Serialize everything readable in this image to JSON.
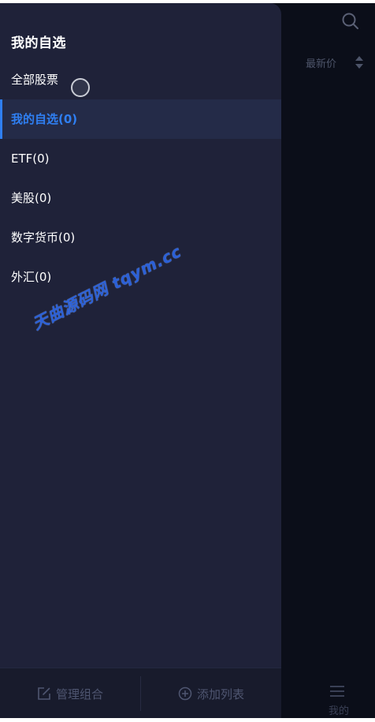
{
  "background": {
    "sort_label": "最新价",
    "nav_label": "我的"
  },
  "drawer": {
    "title": "我的自选",
    "items": [
      {
        "label": "全部股票",
        "active": false
      },
      {
        "label": "我的自选(0)",
        "active": true
      },
      {
        "label": "ETF(0)",
        "active": false
      },
      {
        "label": "美股(0)",
        "active": false
      },
      {
        "label": "数字货币(0)",
        "active": false
      },
      {
        "label": "外汇(0)",
        "active": false
      }
    ],
    "footer": {
      "manage_label": "管理组合",
      "add_label": "添加列表"
    }
  },
  "watermark": "天曲源码网 tqym.cc",
  "colors": {
    "drawer_bg": "#1f2239",
    "accent": "#2f7ff2",
    "screen_bg": "#0b0e19"
  },
  "icons": {
    "search": "search-icon",
    "sort": "sort-arrows-icon",
    "menu": "menu-icon",
    "edit": "edit-icon",
    "add": "plus-circle-icon"
  }
}
